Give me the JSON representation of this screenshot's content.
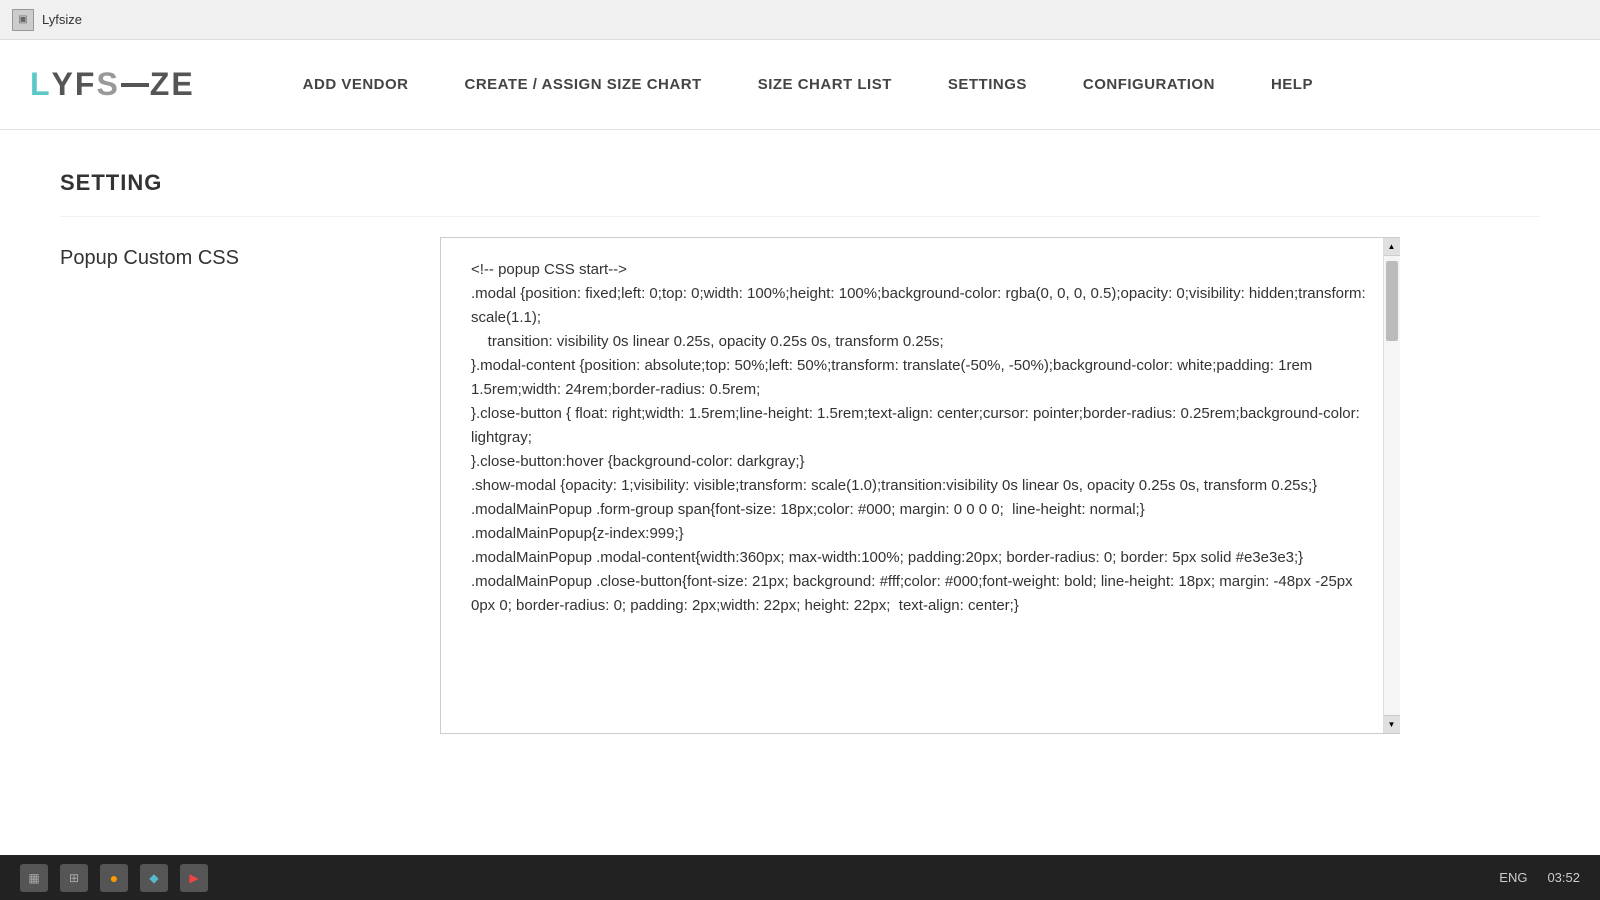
{
  "titlebar": {
    "icon_label": "🖥",
    "app_name": "Lyfsize"
  },
  "navbar": {
    "logo": {
      "l": "L",
      "y": "Y",
      "f": "F",
      "s": "S",
      "z": "Z",
      "e": "E"
    },
    "nav_items": [
      {
        "id": "add-vendor",
        "label": "ADD VENDOR"
      },
      {
        "id": "create-assign",
        "label": "CREATE / ASSIGN SIZE CHART"
      },
      {
        "id": "size-chart-list",
        "label": "SIZE CHART LIST"
      },
      {
        "id": "settings",
        "label": "SETTINGS"
      },
      {
        "id": "configuration",
        "label": "CONFIGURATION"
      },
      {
        "id": "help",
        "label": "HELP"
      }
    ]
  },
  "main": {
    "section_title": "SETTING",
    "popup_css_label": "Popup Custom CSS",
    "css_content": "<!-- popup CSS start-->\n.modal {position: fixed;left: 0;top: 0;width: 100%;height: 100%;background-color: rgba(0, 0, 0, 0.5);opacity: 0;visibility: hidden;transform: scale(1.1);\n    transition: visibility 0s linear 0.25s, opacity 0.25s 0s, transform 0.25s;\n}.modal-content {position: absolute;top: 50%;left: 50%;transform: translate(-50%, -50%);background-color: white;padding: 1rem 1.5rem;width: 24rem;border-radius: 0.5rem;\n}.close-button { float: right;width: 1.5rem;line-height: 1.5rem;text-align: center;cursor: pointer;border-radius: 0.25rem;background-color: lightgray;\n}.close-button:hover {background-color: darkgray;}\n.show-modal {opacity: 1;visibility: visible;transform: scale(1.0);transition:visibility 0s linear 0s, opacity 0.25s 0s, transform 0.25s;}\n.modalMainPopup .form-group span{font-size: 18px;color: #000; margin: 0 0 0 0;  line-height: normal;}\n.modalMainPopup{z-index:999;}\n.modalMainPopup .modal-content{width:360px; max-width:100%; padding:20px; border-radius: 0; border: 5px solid #e3e3e3;}\n.modalMainPopup .close-button{font-size: 21px; background: #fff;color: #000;font-weight: bold; line-height: 18px; margin: -48px -25px 0px 0; border-radius: 0; padding: 2px;width: 22px; height: 22px;  text-align: center;}"
  },
  "taskbar": {
    "time": "03:52",
    "lang": "ENG"
  }
}
